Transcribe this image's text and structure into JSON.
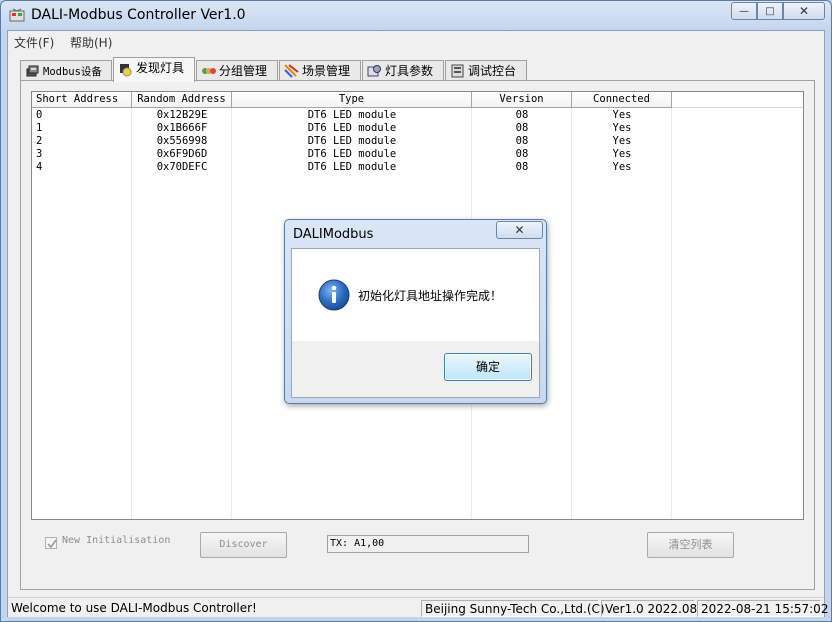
{
  "window": {
    "title": "DALI-Modbus Controller Ver1.0",
    "caption_buttons": {
      "minimize": "—",
      "maximize": "□",
      "close": "✕"
    }
  },
  "menu": [
    "文件(F)",
    "帮助(H)"
  ],
  "tabs": [
    {
      "label": "Modbus设备",
      "icon": "network-device-icon",
      "active": false
    },
    {
      "label": "发现灯具",
      "icon": "discover-lamp-icon",
      "active": true
    },
    {
      "label": "分组管理",
      "icon": "group-icon",
      "active": false
    },
    {
      "label": "场景管理",
      "icon": "scene-icon",
      "active": false
    },
    {
      "label": "灯具参数",
      "icon": "lamp-params-icon",
      "active": false
    },
    {
      "label": "调试控台",
      "icon": "debug-console-icon",
      "active": false
    }
  ],
  "table": {
    "columns": [
      "Short Address",
      "Random Address",
      "Type",
      "Version",
      "Connected"
    ],
    "rows": [
      [
        "0",
        "0x12B29E",
        "DT6 LED module",
        "08",
        "Yes"
      ],
      [
        "1",
        "0x1B666F",
        "DT6 LED module",
        "08",
        "Yes"
      ],
      [
        "2",
        "0x556998",
        "DT6 LED module",
        "08",
        "Yes"
      ],
      [
        "3",
        "0x6F9D6D",
        "DT6 LED module",
        "08",
        "Yes"
      ],
      [
        "4",
        "0x70DEFC",
        "DT6 LED module",
        "08",
        "Yes"
      ]
    ]
  },
  "controls": {
    "new_init_label": "New Initialisation",
    "new_init_checked": true,
    "discover_label": "Discover",
    "tx_value": "TX: A1,00",
    "clear_list_label": "清空列表"
  },
  "statusbar": {
    "welcome": "Welcome to use DALI-Modbus Controller!",
    "company": "Beijing Sunny-Tech Co.,Ltd.(C)",
    "version": "Ver1.0 2022.08",
    "datetime": "2022-08-21 15:57:02"
  },
  "dialog": {
    "title": "DALIModbus",
    "close_glyph": "✕",
    "message": "初始化灯具地址操作完成！",
    "ok_label": "确定",
    "icon": "info-icon"
  },
  "colors": {
    "accent": "#3c7fb1",
    "disabled_text": "#8e8e8e"
  }
}
